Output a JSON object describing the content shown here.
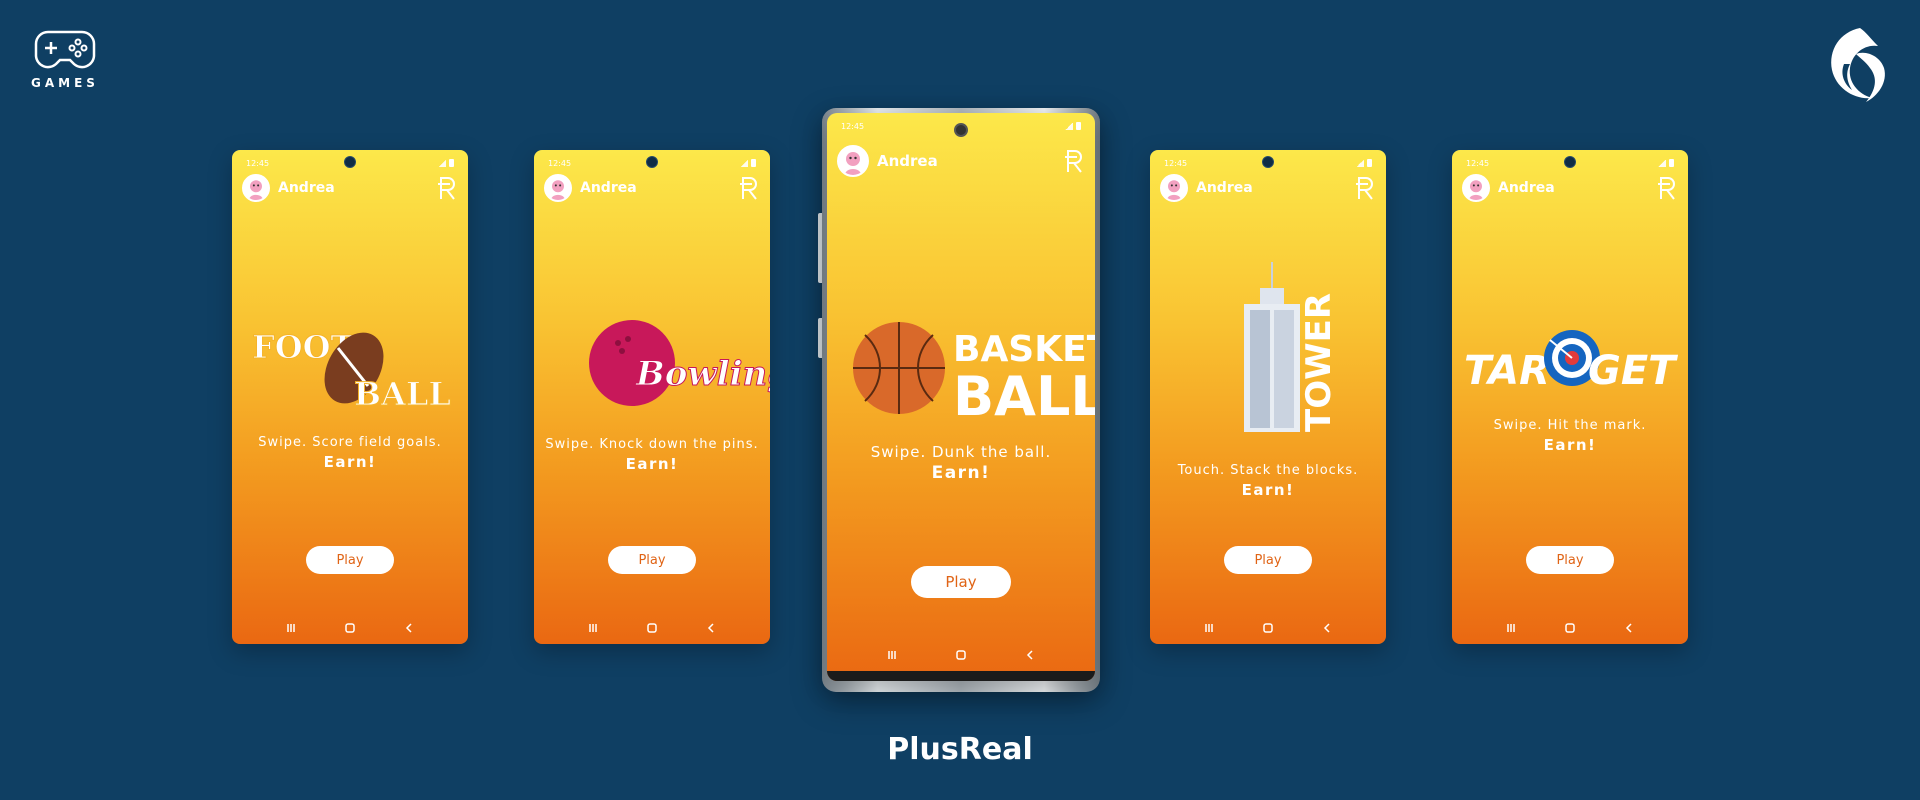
{
  "brand": {
    "games_label": "GAMES"
  },
  "footer": {
    "title": "PlusReal"
  },
  "phones": [
    {
      "time": "12:45",
      "user": "Andrea",
      "title_line1": "FOOT",
      "title_line2": "BALL",
      "tagline": "Swipe. Score field goals.",
      "earn": "Earn!",
      "play": "Play"
    },
    {
      "time": "12:45",
      "user": "Andrea",
      "title_line1": "Bowling",
      "tagline": "Swipe. Knock down the pins.",
      "earn": "Earn!",
      "play": "Play"
    },
    {
      "time": "12:45",
      "user": "Andrea",
      "title_line1": "BASKET",
      "title_line2": "BALL",
      "tagline": "Swipe. Dunk the ball.",
      "earn": "Earn!",
      "play": "Play"
    },
    {
      "time": "12:45",
      "user": "Andrea",
      "title_line1": "TOWER",
      "tagline": "Touch. Stack the blocks.",
      "earn": "Earn!",
      "play": "Play"
    },
    {
      "time": "12:45",
      "user": "Andrea",
      "title_line1": "TAR",
      "title_line2": "GET",
      "tagline": "Swipe. Hit the mark.",
      "earn": "Earn!",
      "play": "Play"
    }
  ],
  "colors": {
    "background": "#0f3f63",
    "gradient_top": "#fce84a",
    "gradient_bottom": "#ea6812",
    "play_text": "#e06416"
  },
  "icons": {
    "brand_left": "gamepad-icon",
    "brand_right": "bird-logo-icon",
    "nav": [
      "recent-apps-icon",
      "home-icon",
      "back-icon"
    ],
    "currency": "r-coin-icon"
  }
}
